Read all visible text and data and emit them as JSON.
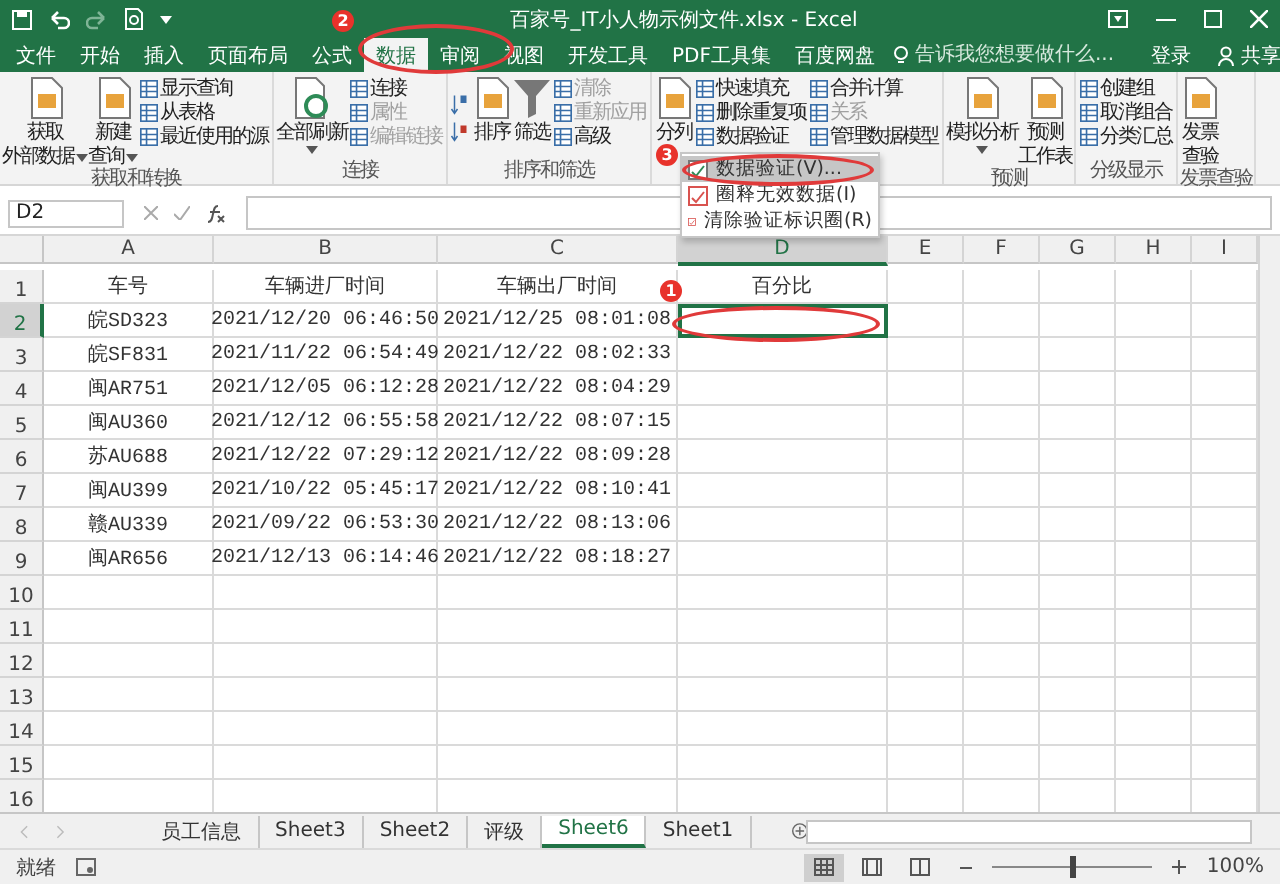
{
  "window": {
    "title": "百家号_IT小人物示例文件.xlsx - Excel"
  },
  "menu_tabs": [
    {
      "label": "文件",
      "selected": false
    },
    {
      "label": "开始",
      "selected": false
    },
    {
      "label": "插入",
      "selected": false
    },
    {
      "label": "页面布局",
      "selected": false
    },
    {
      "label": "公式",
      "selected": false
    },
    {
      "label": "数据",
      "selected": true
    },
    {
      "label": "审阅",
      "selected": false
    },
    {
      "label": "视图",
      "selected": false
    },
    {
      "label": "开发工具",
      "selected": false
    },
    {
      "label": "PDF工具集",
      "selected": false
    },
    {
      "label": "百度网盘",
      "selected": false
    }
  ],
  "tell_me": {
    "placeholder": "告诉我您想要做什么..."
  },
  "account": {
    "sign_in": "登录",
    "share": "共享"
  },
  "ribbon": {
    "groups": [
      {
        "label": "获取和转换",
        "items": [
          {
            "kind": "large",
            "lines": [
              "获取",
              "外部数据"
            ],
            "dropdown": true
          },
          {
            "kind": "large",
            "lines": [
              "新建",
              "查询"
            ],
            "dropdown": true
          },
          {
            "kind": "stack",
            "items": [
              {
                "label": "显示查询",
                "disabled": false
              },
              {
                "label": "从表格",
                "disabled": false
              },
              {
                "label": "最近使用的源",
                "disabled": false
              }
            ]
          }
        ]
      },
      {
        "label": "连接",
        "items": [
          {
            "kind": "large",
            "lines": [
              "全部刷新"
            ],
            "dropdown": true
          },
          {
            "kind": "stack",
            "items": [
              {
                "label": "连接",
                "disabled": false
              },
              {
                "label": "属性",
                "disabled": true
              },
              {
                "label": "编辑链接",
                "disabled": true
              }
            ]
          }
        ]
      },
      {
        "label": "排序和筛选",
        "items": [
          {
            "kind": "sort"
          },
          {
            "kind": "large",
            "lines": [
              "排序"
            ],
            "dropdown": false
          },
          {
            "kind": "large",
            "lines": [
              "筛选"
            ],
            "dropdown": false
          },
          {
            "kind": "stack",
            "items": [
              {
                "label": "清除",
                "disabled": true
              },
              {
                "label": "重新应用",
                "disabled": true
              },
              {
                "label": "高级",
                "disabled": false
              }
            ]
          }
        ]
      },
      {
        "items": [
          {
            "kind": "large",
            "lines": [
              "分列"
            ],
            "dropdown": false
          },
          {
            "kind": "stack",
            "items": [
              {
                "label": "快速填充",
                "disabled": false
              },
              {
                "label": "删除重复项",
                "disabled": false
              },
              {
                "label": "数据验证",
                "disabled": false
              }
            ]
          },
          {
            "kind": "stack",
            "items": [
              {
                "label": "合并计算",
                "disabled": false
              },
              {
                "label": "关系",
                "disabled": true
              },
              {
                "label": "管理数据模型",
                "disabled": false
              }
            ]
          }
        ]
      },
      {
        "label": "预测",
        "items": [
          {
            "kind": "large",
            "lines": [
              "模拟分析"
            ],
            "dropdown": true
          },
          {
            "kind": "large",
            "lines": [
              "预测",
              "工作表"
            ],
            "dropdown": false
          }
        ]
      },
      {
        "label": "分级显示",
        "items": [
          {
            "kind": "stack",
            "items": [
              {
                "label": "创建组",
                "disabled": false
              },
              {
                "label": "取消组合",
                "disabled": false
              },
              {
                "label": "分类汇总",
                "disabled": false
              }
            ]
          }
        ]
      },
      {
        "label": "发票查验",
        "items": [
          {
            "kind": "large",
            "lines": [
              "发票",
              "查验"
            ],
            "dropdown": false
          }
        ]
      }
    ]
  },
  "validation_menu": [
    {
      "label": "数据验证(V)...",
      "selected": true
    },
    {
      "label": "圈释无效数据(I)",
      "selected": false
    },
    {
      "label": "清除验证标识圈(R)",
      "selected": false
    }
  ],
  "formula_bar": {
    "name_box": "D2"
  },
  "grid": {
    "columns": [
      {
        "label": "A",
        "selected": false
      },
      {
        "label": "B",
        "selected": false
      },
      {
        "label": "C",
        "selected": false
      },
      {
        "label": "D",
        "selected": true
      },
      {
        "label": "E",
        "selected": false
      },
      {
        "label": "F",
        "selected": false
      },
      {
        "label": "G",
        "selected": false
      },
      {
        "label": "H",
        "selected": false
      },
      {
        "label": "I",
        "selected": false
      }
    ],
    "rows": [
      {
        "number": "1",
        "selected": false,
        "cells": [
          "车号",
          "车辆进厂时间",
          "车辆出厂时间",
          "百分比"
        ]
      },
      {
        "number": "2",
        "selected": true,
        "cells": [
          "皖SD323",
          "2021/12/20 06:46:50",
          "2021/12/25 08:01:08"
        ]
      },
      {
        "number": "3",
        "selected": false,
        "cells": [
          "皖SF831",
          "2021/11/22 06:54:49",
          "2021/12/22 08:02:33"
        ]
      },
      {
        "number": "4",
        "selected": false,
        "cells": [
          "闽AR751",
          "2021/12/05 06:12:28",
          "2021/12/22 08:04:29"
        ]
      },
      {
        "number": "5",
        "selected": false,
        "cells": [
          "闽AU360",
          "2021/12/12 06:55:58",
          "2021/12/22 08:07:15"
        ]
      },
      {
        "number": "6",
        "selected": false,
        "cells": [
          "苏AU688",
          "2021/12/22 07:29:12",
          "2021/12/22 08:09:28"
        ]
      },
      {
        "number": "7",
        "selected": false,
        "cells": [
          "闽AU399",
          "2021/10/22 05:45:17",
          "2021/12/22 08:10:41"
        ]
      },
      {
        "number": "8",
        "selected": false,
        "cells": [
          "赣AU339",
          "2021/09/22 06:53:30",
          "2021/12/22 08:13:06"
        ]
      },
      {
        "number": "9",
        "selected": false,
        "cells": [
          "闽AR656",
          "2021/12/13 06:14:46",
          "2021/12/22 08:18:27"
        ]
      },
      {
        "number": "10",
        "selected": false,
        "cells": []
      },
      {
        "number": "11",
        "selected": false,
        "cells": []
      },
      {
        "number": "12",
        "selected": false,
        "cells": []
      },
      {
        "number": "13",
        "selected": false,
        "cells": []
      },
      {
        "number": "14",
        "selected": false,
        "cells": []
      },
      {
        "number": "15",
        "selected": false,
        "cells": []
      },
      {
        "number": "16",
        "selected": false,
        "cells": []
      }
    ]
  },
  "sheet_tabs": [
    {
      "label": "员工信息",
      "selected": false
    },
    {
      "label": "Sheet3",
      "selected": false
    },
    {
      "label": "Sheet2",
      "selected": false
    },
    {
      "label": "评级",
      "selected": false
    },
    {
      "label": "Sheet6",
      "selected": true
    },
    {
      "label": "Sheet1",
      "selected": false
    }
  ],
  "status_bar": {
    "text": "就绪",
    "views": [
      {
        "selected": true
      },
      {
        "selected": false
      },
      {
        "selected": false
      }
    ],
    "zoom": {
      "level": 0.5,
      "reading": "100%"
    }
  },
  "annotations": {
    "cell_marker": "1",
    "tab_marker": "2",
    "menu_marker": "3"
  }
}
